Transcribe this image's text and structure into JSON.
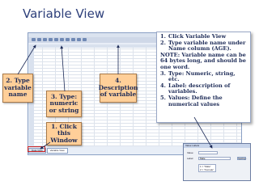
{
  "slide": {
    "title": "Variable View"
  },
  "spss_window": {
    "tabs": [
      "Data View",
      "Variable View"
    ]
  },
  "callouts": {
    "type": "2. Type variable name",
    "description": "4. Description of variable",
    "type_numeric": "3. Type: numeric or string",
    "click_window": "1. Click this Window"
  },
  "instructions": {
    "item1": {
      "num": "1.",
      "text": "Click Variable View"
    },
    "item2": {
      "num": "2.",
      "text": "Type variable name under Name column (AGE)."
    },
    "note": "NOTE: Variable name can be 64 bytes long, and should be one word.",
    "item3": {
      "num": "3.",
      "text": "Type: Numeric, string, etc."
    },
    "item4": {
      "num": "4.",
      "text": "Label: description of variables."
    },
    "item5": {
      "num": "5.",
      "text": "Values: Define the numerical values"
    }
  },
  "value_labels_dialog": {
    "title": "Value Labels",
    "value_label": "Value:",
    "label_label": "Label:",
    "label_value": "Male",
    "list_items": [
      "1 = \"Male\"",
      "2 = \"Female\""
    ],
    "spelling_button": "Spelling..."
  },
  "colors": {
    "callout": "#ffcf99",
    "title": "#2d3f7a",
    "text": "#1d2b57",
    "arrow": "#1d2b57",
    "highlight": "#cc2222"
  }
}
